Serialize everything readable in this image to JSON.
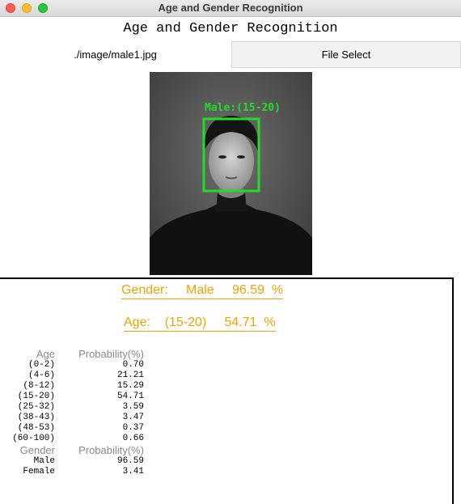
{
  "window": {
    "title": "Age and Gender Recognition"
  },
  "heading": "Age and Gender Recognition",
  "file": {
    "path": "./image/male1.jpg",
    "button_label": "File Select"
  },
  "detection": {
    "label": "Male:(15-20)",
    "box_color": "#22dd22"
  },
  "summary": {
    "gender": "Gender:     Male     96.59  %",
    "age": "Age:    (15-20)     54.71  %"
  },
  "age_table": {
    "headers": [
      "Age",
      "Probability(%)"
    ],
    "rows": [
      [
        "(0-2)",
        "0.70"
      ],
      [
        "(4-6)",
        "21.21"
      ],
      [
        "(8-12)",
        "15.29"
      ],
      [
        "(15-20)",
        "54.71"
      ],
      [
        "(25-32)",
        "3.59"
      ],
      [
        "(38-43)",
        "3.47"
      ],
      [
        "(48-53)",
        "0.37"
      ],
      [
        "(60-100)",
        "0.66"
      ]
    ]
  },
  "gender_table": {
    "headers": [
      "Gender",
      "Probability(%)"
    ],
    "rows": [
      [
        "Male",
        "96.59"
      ],
      [
        "Female",
        "3.41"
      ]
    ]
  },
  "colors": {
    "accent": "#f0a300",
    "detection": "#22dd22"
  }
}
